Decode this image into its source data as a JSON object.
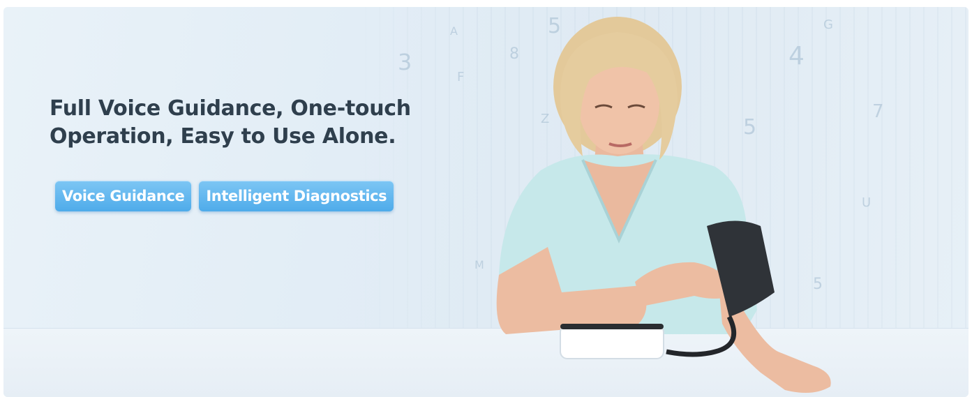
{
  "banner": {
    "headline_line1": "Full Voice Guidance, One-touch",
    "headline_line2": "Operation, Easy to Use Alone.",
    "tags": [
      {
        "label": "Voice Guidance"
      },
      {
        "label": "Intelligent Diagnostics"
      }
    ]
  },
  "colors": {
    "headline": "#2f3f4d",
    "tag_background": "#4eabea",
    "tag_text": "#ffffff",
    "background": "#e2edf6"
  }
}
